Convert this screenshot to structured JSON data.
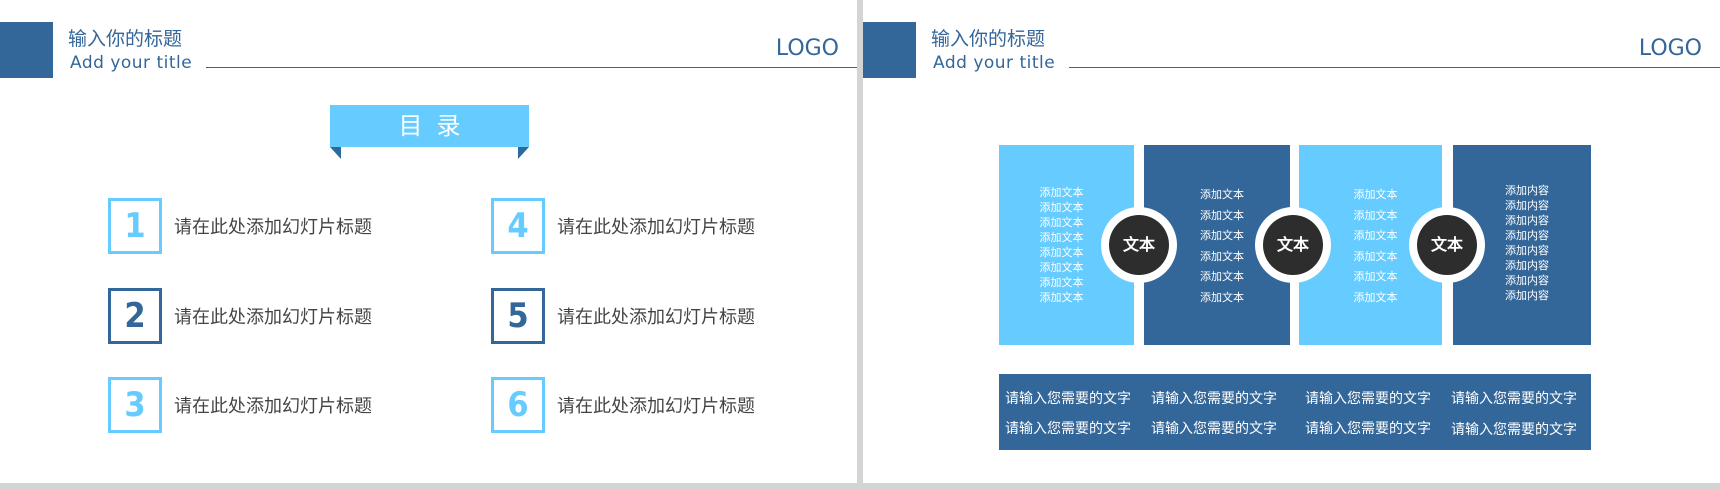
{
  "slide_left": {
    "header": {
      "title_cn": "输入你的标题",
      "title_en": "Add your title",
      "logo": "LOGO"
    },
    "ribbon_label": "目录",
    "toc": [
      {
        "number": "1",
        "label": "请在此处添加幻灯片标题",
        "style": "light"
      },
      {
        "number": "2",
        "label": "请在此处添加幻灯片标题",
        "style": "dark"
      },
      {
        "number": "3",
        "label": "请在此处添加幻灯片标题",
        "style": "light"
      },
      {
        "number": "4",
        "label": "请在此处添加幻灯片标题",
        "style": "light"
      },
      {
        "number": "5",
        "label": "请在此处添加幻灯片标题",
        "style": "dark"
      },
      {
        "number": "6",
        "label": "请在此处添加幻灯片标题",
        "style": "light"
      }
    ]
  },
  "slide_right": {
    "header": {
      "title_cn": "输入你的标题",
      "title_en": "Add your title",
      "logo": "LOGO"
    },
    "columns": [
      {
        "style": "light",
        "lines": [
          "添加文本",
          "添加文本",
          "添加文本",
          "添加文本",
          "添加文本",
          "添加文本",
          "添加文本",
          "添加文本"
        ]
      },
      {
        "style": "dark",
        "lines": [
          "添加文本",
          "添加文本",
          "添加文本",
          "添加文本",
          "添加文本",
          "添加文本"
        ]
      },
      {
        "style": "light",
        "lines": [
          "添加文本",
          "添加文本",
          "添加文本",
          "添加文本",
          "添加文本",
          "添加文本"
        ]
      },
      {
        "style": "dark",
        "lines": [
          "添加内容",
          "添加内容",
          "添加内容",
          "添加内容",
          "添加内容",
          "添加内容",
          "添加内容",
          "添加内容"
        ]
      }
    ],
    "circles": [
      "文本",
      "文本",
      "文本"
    ],
    "bottom_rows": [
      [
        "请输入您需要的文字",
        "请输入您需要的文字",
        "请输入您需要的文字",
        "请输入您需要的文字"
      ],
      [
        "请输入您需要的文字",
        "请输入您需要的文字",
        "请输入您需要的文字",
        "请输入您需要的文字"
      ]
    ]
  },
  "colors": {
    "dark_blue": "#336699",
    "light_blue": "#66ccff",
    "circle": "#2d2d2d",
    "text": "#444444"
  }
}
